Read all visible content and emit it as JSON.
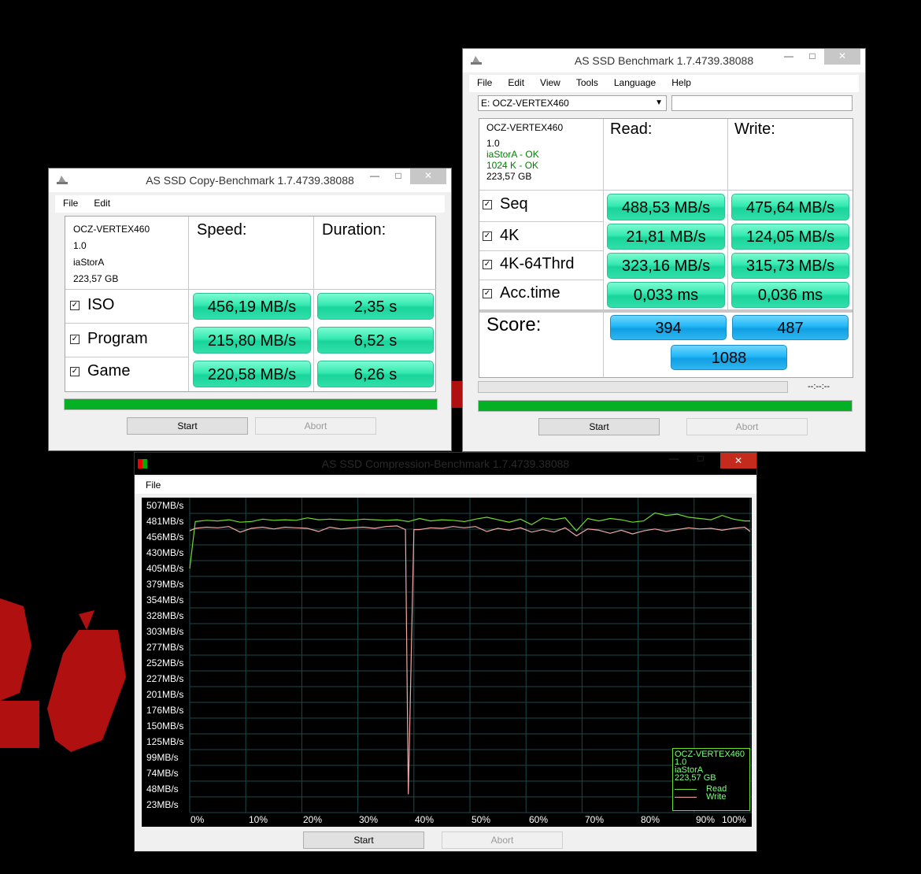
{
  "colors": {
    "read_line": "#6edc2a",
    "write_line": "#f4a6a6",
    "green_result": "#34e9b0",
    "blue_score": "#21b8f6",
    "progress": "#06b025",
    "grid": "#1a4a4a"
  },
  "copy_window": {
    "title": "AS SSD Copy-Benchmark 1.7.4739.38088",
    "menu": [
      "File",
      "Edit"
    ],
    "drive": {
      "name": "OCZ-VERTEX460",
      "version": "1.0",
      "driver": "iaStorA",
      "size": "223,57 GB"
    },
    "headers": {
      "speed": "Speed:",
      "duration": "Duration:"
    },
    "rows": [
      {
        "label": "ISO",
        "speed": "456,19 MB/s",
        "duration": "2,35 s"
      },
      {
        "label": "Program",
        "speed": "215,80 MB/s",
        "duration": "6,52 s"
      },
      {
        "label": "Game",
        "speed": "220,58 MB/s",
        "duration": "6,26 s"
      }
    ],
    "progress": 1.0,
    "start_label": "Start",
    "abort_label": "Abort"
  },
  "bench_window": {
    "title": "AS SSD Benchmark 1.7.4739.38088",
    "menu": [
      "File",
      "Edit",
      "View",
      "Tools",
      "Language",
      "Help"
    ],
    "drive_select": "E: OCZ-VERTEX460",
    "drive": {
      "name": "OCZ-VERTEX460",
      "version": "1.0",
      "driver_status": "iaStorA - OK",
      "align_status": "1024 K - OK",
      "size": "223,57 GB"
    },
    "headers": {
      "read": "Read:",
      "write": "Write:"
    },
    "rows": [
      {
        "label": "Seq",
        "read": "488,53 MB/s",
        "write": "475,64 MB/s"
      },
      {
        "label": "4K",
        "read": "21,81 MB/s",
        "write": "124,05 MB/s"
      },
      {
        "label": "4K-64Thrd",
        "read": "323,16 MB/s",
        "write": "315,73 MB/s"
      },
      {
        "label": "Acc.time",
        "read": "0,033 ms",
        "write": "0,036 ms"
      }
    ],
    "score_label": "Score:",
    "score_read": "394",
    "score_write": "487",
    "score_total": "1088",
    "time_text": "--:--:--",
    "progress": 1.0,
    "start_label": "Start",
    "abort_label": "Abort"
  },
  "compression_window": {
    "title": "AS SSD Compression-Benchmark 1.7.4739.38088",
    "menu": [
      "File"
    ],
    "start_label": "Start",
    "abort_label": "Abort",
    "legend": {
      "name": "OCZ-VERTEX460",
      "version": "1.0",
      "driver": "iaStorA",
      "size": "223,57 GB",
      "read": "Read",
      "write": "Write"
    }
  },
  "chart_data": {
    "type": "line",
    "y_tick_labels": [
      "507MB/s",
      "481MB/s",
      "456MB/s",
      "430MB/s",
      "405MB/s",
      "379MB/s",
      "354MB/s",
      "328MB/s",
      "303MB/s",
      "277MB/s",
      "252MB/s",
      "227MB/s",
      "201MB/s",
      "176MB/s",
      "150MB/s",
      "125MB/s",
      "99MB/s",
      "74MB/s",
      "48MB/s",
      "23MB/s"
    ],
    "x_tick_labels": [
      "0%",
      "10%",
      "20%",
      "30%",
      "40%",
      "50%",
      "60%",
      "70%",
      "80%",
      "90%",
      "100%"
    ],
    "ylim": [
      10,
      515
    ],
    "xlim": [
      0,
      100
    ],
    "grid": true,
    "legend_position": "bottom-right",
    "series": [
      {
        "name": "Read",
        "x": [
          0,
          1,
          3,
          5,
          7,
          9,
          11,
          13,
          15,
          17,
          19,
          21,
          23,
          25,
          27,
          29,
          31,
          33,
          35,
          37,
          39,
          41,
          43,
          45,
          47,
          49,
          51,
          53,
          55,
          57,
          59,
          61,
          63,
          65,
          67,
          69,
          71,
          73,
          75,
          77,
          79,
          81,
          83,
          85,
          87,
          89,
          91,
          93,
          95,
          97,
          99,
          100
        ],
        "y": [
          405,
          481,
          483,
          482,
          484,
          480,
          481,
          485,
          483,
          484,
          483,
          487,
          484,
          485,
          484,
          483,
          485,
          484,
          483,
          484,
          481,
          486,
          482,
          484,
          483,
          481,
          485,
          488,
          484,
          480,
          485,
          476,
          487,
          484,
          487,
          466,
          486,
          482,
          486,
          484,
          480,
          482,
          495,
          491,
          493,
          488,
          486,
          484,
          491,
          485,
          482,
          482
        ]
      },
      {
        "name": "Write",
        "x": [
          0,
          1,
          3,
          5,
          7,
          9,
          11,
          13,
          15,
          17,
          19,
          21,
          23,
          25,
          27,
          29,
          31,
          33,
          35,
          37,
          38.5,
          39,
          40,
          41,
          43,
          45,
          47,
          49,
          51,
          53,
          55,
          57,
          59,
          61,
          63,
          65,
          67,
          69,
          71,
          73,
          75,
          77,
          79,
          81,
          83,
          85,
          87,
          89,
          91,
          93,
          95,
          97,
          99,
          100
        ],
        "y": [
          466,
          470,
          472,
          471,
          473,
          464,
          470,
          472,
          469,
          472,
          471,
          470,
          465,
          472,
          469,
          471,
          472,
          470,
          473,
          474,
          468,
          40,
          468,
          468,
          471,
          470,
          473,
          471,
          473,
          465,
          470,
          467,
          471,
          464,
          468,
          464,
          471,
          458,
          469,
          467,
          462,
          467,
          461,
          466,
          469,
          465,
          468,
          471,
          469,
          470,
          467,
          470,
          472,
          465
        ]
      }
    ]
  }
}
